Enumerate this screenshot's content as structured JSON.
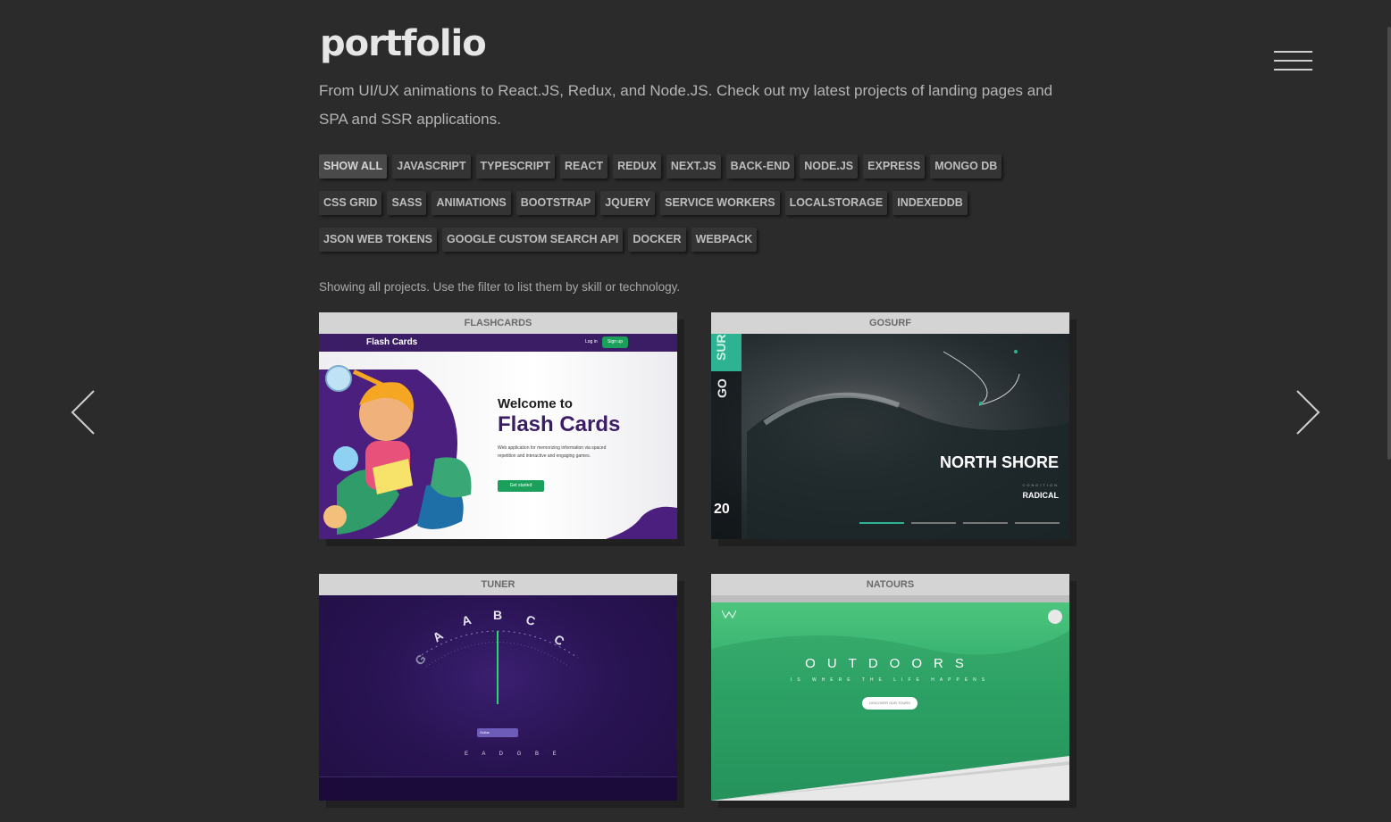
{
  "header": {
    "logo": "portfolio",
    "intro": "From UI/UX animations to React.JS, Redux, and Node.JS. Check out my latest projects of landing pages and SPA and SSR applications.",
    "menu_icon": "hamburger-menu-icon"
  },
  "filters": [
    "SHOW ALL",
    "JAVASCRIPT",
    "TYPESCRIPT",
    "REACT",
    "REDUX",
    "NEXT.JS",
    "BACK-END",
    "NODE.JS",
    "EXPRESS",
    "MONGO DB",
    "CSS GRID",
    "SASS",
    "ANIMATIONS",
    "BOOTSTRAP",
    "JQUERY",
    "SERVICE WORKERS",
    "LOCALSTORAGE",
    "INDEXEDDB",
    "JSON WEB TOKENS",
    "GOOGLE CUSTOM SEARCH API",
    "DOCKER",
    "WEBPACK"
  ],
  "active_filter": "SHOW ALL",
  "showing_text": "Showing all projects. Use the filter to list them by skill or technology.",
  "projects": [
    {
      "title": "FLASHCARDS",
      "preview": {
        "app_name": "Flash Cards",
        "login": "Log in",
        "signup": "Sign up",
        "welcome": "Welcome to",
        "headline": "Flash Cards",
        "description": "Web application for memorizing information via spaced repetition and interactive and engaging games.",
        "cta": "Get started"
      }
    },
    {
      "title": "GOSURF",
      "preview": {
        "brand_top": "SURF",
        "brand_bottom": "GO",
        "day": "20",
        "location": "NORTH SHORE",
        "condition_label": "CONDITION",
        "condition": "RADICAL"
      }
    },
    {
      "title": "TUNER",
      "preview": {
        "notes": [
          "G",
          "A",
          "A",
          "B",
          "C",
          "C"
        ],
        "select": "Guitar",
        "strings": "E A D G B E"
      }
    },
    {
      "title": "NATOURS",
      "preview": {
        "headline": "OUTDOORS",
        "subline": "IS WHERE THE LIFE HAPPENS",
        "cta": "DISCOVER OUR TOURS"
      }
    }
  ],
  "nav": {
    "prev_icon": "chevron-left-icon",
    "next_icon": "chevron-right-icon"
  },
  "colors": {
    "background": "#2b2b2b",
    "card_header": "#d4d4d4",
    "accent_green": "#2db391",
    "accent_purple": "#3b1d66"
  }
}
